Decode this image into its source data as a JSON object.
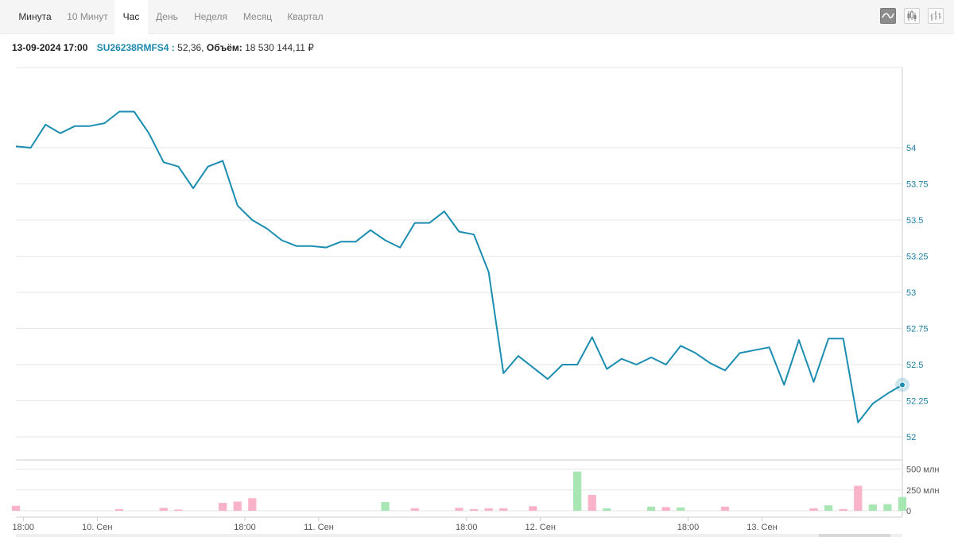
{
  "tabs": [
    {
      "label": "Минута",
      "active": false
    },
    {
      "label": "10 Минут",
      "active": false
    },
    {
      "label": "Час",
      "active": true
    },
    {
      "label": "День",
      "active": false
    },
    {
      "label": "Неделя",
      "active": false
    },
    {
      "label": "Месяц",
      "active": false
    },
    {
      "label": "Квартал",
      "active": false
    }
  ],
  "view_buttons": [
    {
      "icon": "line-chart-icon",
      "active": true
    },
    {
      "icon": "candlestick-icon",
      "active": false
    },
    {
      "icon": "ohlc-bars-icon",
      "active": false
    }
  ],
  "info": {
    "datetime": "13-09-2024 17:00",
    "ticker": "SU26238RMFS4 :",
    "price": "52,36,",
    "volume_label": "Объём:",
    "volume": "18 530 144,11 ₽"
  },
  "colors": {
    "line": "#1b8db0",
    "up_volume": "#a8e6b4",
    "down_volume": "#f9b3c8",
    "grid": "#e6e6e6",
    "axis_text": "#1e7fa3"
  },
  "chart_data": {
    "type": "line",
    "x_tick_labels": [
      "18:00",
      "10. Сен",
      "18:00",
      "11. Сен",
      "18:00",
      "12. Сен",
      "18:00",
      "13. Сен"
    ],
    "x_tick_index": [
      0.5,
      5.5,
      15.5,
      20.5,
      30.5,
      35.5,
      45.5,
      50.5
    ],
    "ylim": [
      52,
      54.5
    ],
    "y_ticks": [
      52,
      52.25,
      52.5,
      52.75,
      53,
      53.25,
      53.5,
      53.75,
      54
    ],
    "y_tick_labels": [
      "52",
      "52.25",
      "52.5",
      "52.75",
      "53",
      "53.25",
      "53.5",
      "53.75",
      "54"
    ],
    "grid": true,
    "price": [
      54.01,
      54.0,
      54.16,
      54.1,
      54.15,
      54.15,
      54.17,
      54.25,
      54.25,
      54.1,
      53.9,
      53.87,
      53.72,
      53.87,
      53.91,
      53.6,
      53.5,
      53.44,
      53.36,
      53.32,
      53.32,
      53.31,
      53.35,
      53.35,
      53.43,
      53.36,
      53.31,
      53.48,
      53.48,
      53.56,
      53.42,
      53.4,
      53.14,
      52.44,
      52.56,
      52.48,
      52.4,
      52.5,
      52.5,
      52.69,
      52.47,
      52.54,
      52.5,
      52.55,
      52.5,
      52.63,
      52.58,
      52.51,
      52.46,
      52.58,
      52.6,
      52.62,
      52.36,
      52.67,
      52.38,
      52.68,
      52.68,
      52.1,
      52.23,
      52.3,
      52.36
    ],
    "volume_ylim": [
      0,
      600
    ],
    "volume_ticks": [
      0,
      250,
      500
    ],
    "volume_tick_labels": [
      "0",
      "250 млн",
      "500 млн"
    ],
    "volume": [
      60,
      0,
      0,
      0,
      0,
      0,
      0,
      20,
      0,
      0,
      35,
      15,
      0,
      0,
      95,
      110,
      150,
      0,
      0,
      0,
      0,
      0,
      0,
      0,
      0,
      105,
      0,
      30,
      0,
      0,
      35,
      20,
      30,
      30,
      0,
      55,
      0,
      0,
      470,
      190,
      30,
      0,
      0,
      50,
      45,
      40,
      0,
      0,
      50,
      0,
      0,
      0,
      0,
      0,
      30,
      65,
      20,
      300,
      75,
      80,
      165
    ],
    "volume_direction": [
      "down",
      "down",
      "down",
      "down",
      "down",
      "down",
      "down",
      "down",
      "down",
      "down",
      "down",
      "down",
      "down",
      "down",
      "down",
      "down",
      "down",
      "down",
      "down",
      "down",
      "down",
      "down",
      "down",
      "down",
      "down",
      "up",
      "down",
      "down",
      "up",
      "up",
      "down",
      "down",
      "down",
      "down",
      "down",
      "down",
      "down",
      "down",
      "up",
      "down",
      "up",
      "up",
      "up",
      "up",
      "down",
      "up",
      "down",
      "down",
      "down",
      "down",
      "down",
      "down",
      "down",
      "down",
      "down",
      "up",
      "down",
      "down",
      "up",
      "up",
      "up"
    ]
  }
}
